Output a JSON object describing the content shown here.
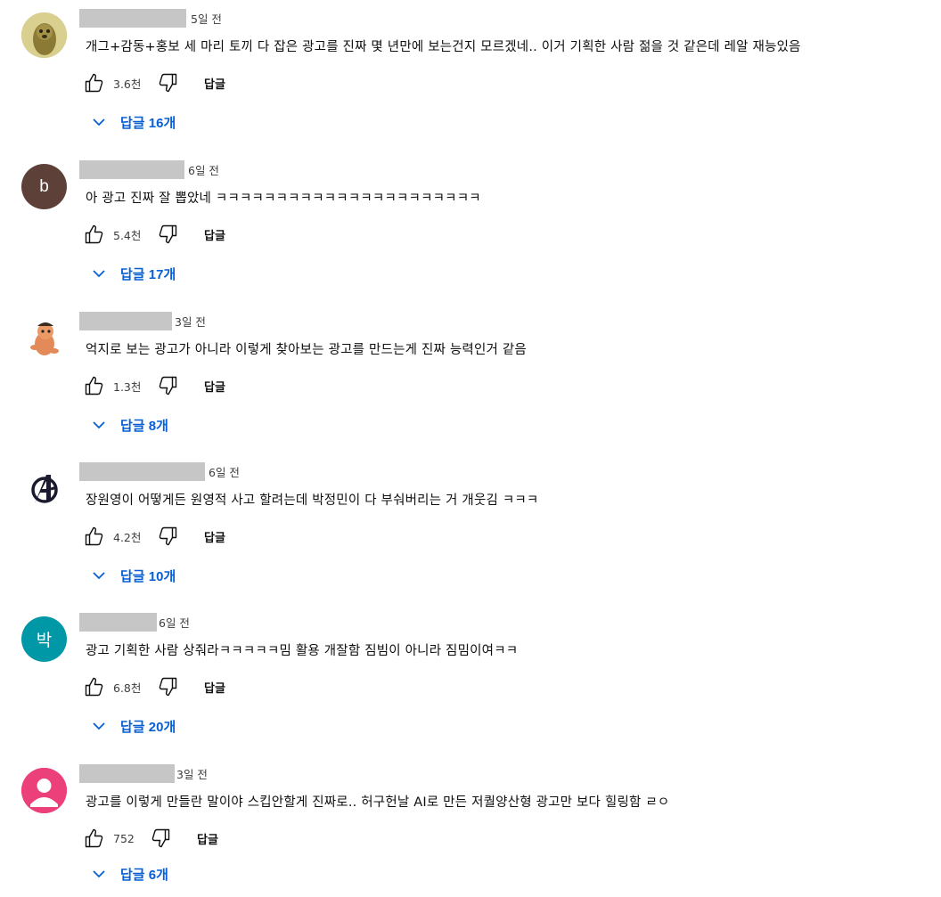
{
  "comments": [
    {
      "time": "5일 전",
      "text": "개그+감동+홍보 세 마리 토끼 다 잡은 광고를 진짜 몇 년만에 보는건지 모르겠네.. 이거 기획한 사람 젊을 것 같은데 레알 재능있음",
      "likes": "3.6천",
      "reply_label": "답글",
      "replies_label": "답글 16개",
      "avatar": {
        "type": "image",
        "icon": "meerkat-avatar",
        "color": "#a89a3c"
      }
    },
    {
      "time": "6일 전",
      "text": "아 광고 진짜 잘 뽑았네 ㅋㅋㅋㅋㅋㅋㅋㅋㅋㅋㅋㅋㅋㅋㅋㅋㅋㅋㅋㅋㅋㅋ",
      "likes": "5.4천",
      "reply_label": "답글",
      "replies_label": "답글 17개",
      "avatar": {
        "type": "letter",
        "letter": "b",
        "color": "#5d4037"
      }
    },
    {
      "time": "3일 전",
      "text": "억지로 보는 광고가 아니라 이렇게 찾아보는 광고를 만드는게 진짜 능력인거 같음",
      "likes": "1.3천",
      "reply_label": "답글",
      "replies_label": "답글 8개",
      "avatar": {
        "type": "image",
        "icon": "cartoon-character-avatar",
        "color": "#e08a5a"
      }
    },
    {
      "time": "6일 전",
      "text": "장원영이 어떻게든 원영적 사고 할려는데 박정민이 다 부숴버리는 거 개웃김 ㅋㅋㅋ",
      "likes": "4.2천",
      "reply_label": "답글",
      "replies_label": "답글 10개",
      "avatar": {
        "type": "image",
        "icon": "avengers-logo-avatar",
        "color": "#1a1a2e"
      }
    },
    {
      "time": "6일 전",
      "text": "광고 기획한 사람 상줘라ㅋㅋㅋㅋㅋ밈 활용 개잘함 짐빔이 아니라 짐밈이여ㅋㅋ",
      "likes": "6.8천",
      "reply_label": "답글",
      "replies_label": "답글 20개",
      "avatar": {
        "type": "letter",
        "letter": "박",
        "color": "#0097a7"
      }
    },
    {
      "time": "3일 전",
      "text": "광고를 이렇게 만들란 말이야 스킵안할게 진짜로.. 허구헌날 AI로 만든 저퀄양산형 광고만 보다 힐링함 ㄹㅇ",
      "likes": "752",
      "reply_label": "답글",
      "replies_label": "답글 6개",
      "avatar": {
        "type": "default",
        "icon": "default-person-avatar",
        "color": "#ec407a"
      }
    }
  ]
}
